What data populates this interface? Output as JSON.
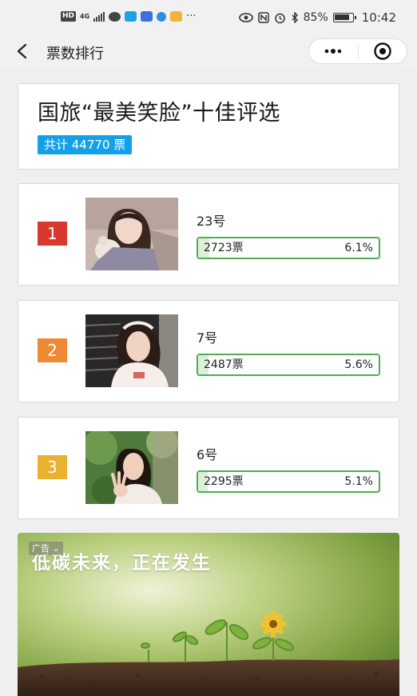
{
  "status_bar": {
    "hd": "HD",
    "network": "4G",
    "dots": "···",
    "battery": "85%",
    "time": "10:42"
  },
  "nav": {
    "title": "票数排行"
  },
  "header": {
    "title": "国旅“最美笑脸”十佳评选",
    "total": "共计 44770 票"
  },
  "ranking": [
    {
      "rank": "1",
      "badge_color": "#d9382e",
      "name": "23号",
      "votes": "2723票",
      "percent": "6.1%",
      "share": 6.1
    },
    {
      "rank": "2",
      "badge_color": "#ee8a33",
      "name": "7号",
      "votes": "2487票",
      "percent": "5.6%",
      "share": 5.6
    },
    {
      "rank": "3",
      "badge_color": "#e8b130",
      "name": "6号",
      "votes": "2295票",
      "percent": "5.1%",
      "share": 5.1
    }
  ],
  "ad": {
    "tag": "广告 ⌄",
    "headline": "低碳未来，正在发生"
  },
  "colors": {
    "accent_blue": "#12a1e8",
    "bar_border": "#4caf50",
    "bar_fill": "#dcefd8"
  }
}
